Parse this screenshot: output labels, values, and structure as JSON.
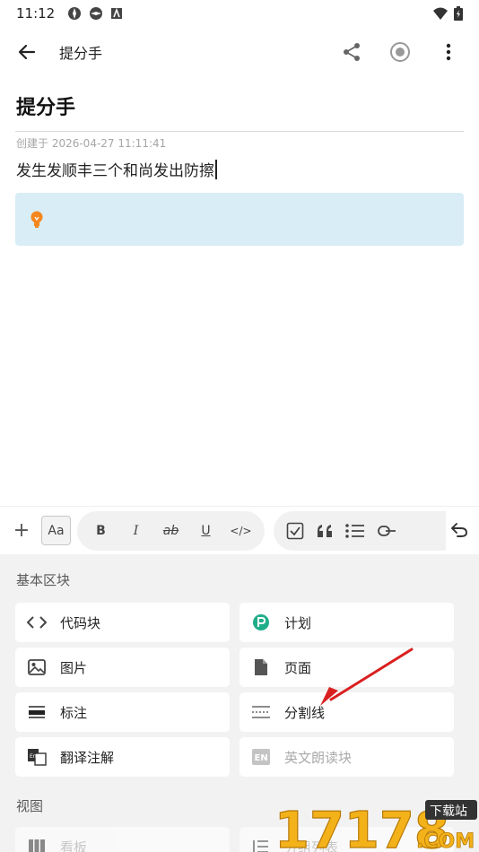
{
  "status": {
    "time": "11:12"
  },
  "app_bar": {
    "title": "提分手"
  },
  "doc": {
    "title": "提分手",
    "created": "创建于 2026-04-27 11:11:41",
    "body": "发生发顺丰三个和尚发出防擦"
  },
  "toolbar": {
    "plus": "+",
    "aa": "Aa",
    "bold": "B",
    "italic": "I",
    "strike": "ab",
    "underline": "U",
    "code": "</>"
  },
  "panel": {
    "basic_blocks_label": "基本区块",
    "view_label": "视图",
    "blocks": [
      {
        "label": "代码块",
        "icon": "code-icon",
        "disabled": false
      },
      {
        "label": "计划",
        "icon": "plan-icon",
        "disabled": false
      },
      {
        "label": "图片",
        "icon": "image-icon",
        "disabled": false
      },
      {
        "label": "页面",
        "icon": "page-icon",
        "disabled": false
      },
      {
        "label": "标注",
        "icon": "highlight-icon",
        "disabled": false
      },
      {
        "label": "分割线",
        "icon": "divider-icon",
        "disabled": false
      },
      {
        "label": "翻译注解",
        "icon": "translate-icon",
        "disabled": false
      },
      {
        "label": "英文朗读块",
        "icon": "en-read-icon",
        "disabled": true
      }
    ],
    "views": [
      {
        "label": "看板",
        "icon": "kanban-icon"
      },
      {
        "label": "分组列表",
        "icon": "group-list-icon"
      }
    ]
  },
  "watermark": {
    "text": "17178",
    "sub": "下载站",
    "suffix": ".COM"
  },
  "colors": {
    "accent": "#1fae8a",
    "callout": "#d8edf6",
    "bulb": "#f5871f",
    "arrow": "#d92020"
  }
}
